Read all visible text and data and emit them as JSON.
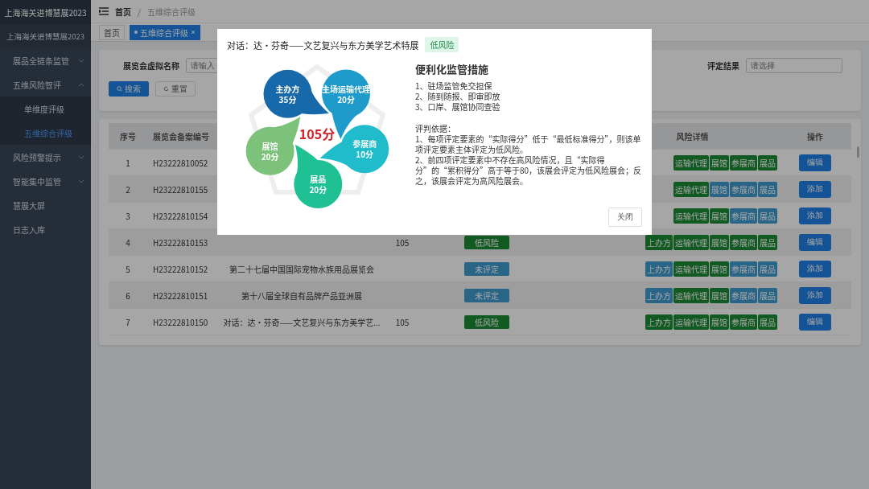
{
  "sidebar": {
    "title": "上海海关进博慧展2023",
    "subtitle": "上海海关进博慧展2023",
    "items": [
      {
        "label": "展品全链条监管",
        "expanded": false,
        "selected": false
      },
      {
        "label": "五维风险智评",
        "expanded": true,
        "selected": false,
        "children": [
          {
            "label": "单维度评级",
            "selected": false
          },
          {
            "label": "五维综合评级",
            "selected": true
          }
        ]
      },
      {
        "label": "风险预警提示",
        "expanded": false,
        "selected": false
      },
      {
        "label": "智能集中监管",
        "expanded": false,
        "selected": false
      },
      {
        "label": "慧展大屏",
        "selected": false
      },
      {
        "label": "日志入库",
        "selected": false
      }
    ]
  },
  "breadcrumb": [
    "首页",
    "五维综合评级"
  ],
  "breadcrumb_separator": "/",
  "tabs": [
    {
      "label": "首页",
      "selected": false
    },
    {
      "label": "五维综合评级",
      "selected": true
    }
  ],
  "search": {
    "fields": [
      {
        "label": "展览会虚拟名称",
        "placeholder": "请输入"
      },
      {
        "label": "评定结果",
        "placeholder": "请选择"
      }
    ],
    "buttons": [
      "搜索",
      "重置"
    ]
  },
  "table": {
    "columns": {
      "seq": "序号",
      "id": "展览会备案编号",
      "risk": "风险详情",
      "action": "操作"
    },
    "rows": [
      {
        "seq": "1",
        "id": "H23222810052",
        "risks": [
          {
            "label": "运输代理",
            "on": true
          },
          {
            "label": "展馆",
            "on": true
          },
          {
            "label": "参展商",
            "on": true
          },
          {
            "label": "展品",
            "on": true
          }
        ],
        "action": "编辑"
      },
      {
        "seq": "2",
        "id": "H23222810155",
        "risks": [
          {
            "label": "运输代理",
            "on": true
          },
          {
            "label": "展馆",
            "on": false
          },
          {
            "label": "参展商",
            "on": false
          },
          {
            "label": "展品",
            "on": false
          }
        ],
        "action": "添加"
      },
      {
        "seq": "3",
        "id": "H23222810154",
        "risks": [
          {
            "label": "运输代理",
            "on": true
          },
          {
            "label": "展馆",
            "on": true
          },
          {
            "label": "参展商",
            "on": false
          },
          {
            "label": "展品",
            "on": false
          }
        ],
        "action": "添加"
      },
      {
        "seq": "4",
        "id": "H23222810153",
        "score": "105",
        "result": {
          "label": "低风险",
          "rated": true
        },
        "risks": [
          {
            "label": "上办方",
            "on": true
          },
          {
            "label": "运输代理",
            "on": true
          },
          {
            "label": "展馆",
            "on": true
          },
          {
            "label": "参展商",
            "on": true
          },
          {
            "label": "展品",
            "on": true
          }
        ],
        "action": "编辑"
      },
      {
        "seq": "5",
        "id": "H23222810152",
        "name": "第二十七届中国国际宠物水族用品展览会",
        "result": {
          "label": "未评定",
          "rated": false
        },
        "risks": [
          {
            "label": "上办方",
            "on": false
          },
          {
            "label": "运输代理",
            "on": true
          },
          {
            "label": "展馆",
            "on": true
          },
          {
            "label": "参展商",
            "on": false
          },
          {
            "label": "展品",
            "on": false
          }
        ],
        "action": "添加"
      },
      {
        "seq": "6",
        "id": "H23222810151",
        "name": "第十八届全球自有品牌产品亚洲展",
        "result": {
          "label": "未评定",
          "rated": false
        },
        "risks": [
          {
            "label": "上办方",
            "on": false
          },
          {
            "label": "运输代理",
            "on": true
          },
          {
            "label": "展馆",
            "on": true
          },
          {
            "label": "参展商",
            "on": false
          },
          {
            "label": "展品",
            "on": false
          }
        ],
        "action": "添加"
      },
      {
        "seq": "7",
        "id": "H23222810150",
        "name": "对话：达·芬奇——文艺复兴与东方美学艺...",
        "score": "105",
        "result": {
          "label": "低风险",
          "rated": true
        },
        "risks": [
          {
            "label": "上办方",
            "on": true
          },
          {
            "label": "运输代理",
            "on": true
          },
          {
            "label": "展馆",
            "on": true
          },
          {
            "label": "参展商",
            "on": true
          },
          {
            "label": "展品",
            "on": true
          }
        ],
        "action": "编辑"
      }
    ]
  },
  "dialog": {
    "title": "对话：达·芬奇——文艺复兴与东方美学艺术特展",
    "badge": "低风险",
    "total": "105分",
    "petals": [
      {
        "name": "主办方",
        "score": "35分",
        "color": "#1769aa"
      },
      {
        "name": "主场运输代理",
        "score": "20分",
        "color": "#1e9bcb"
      },
      {
        "name": "参展商",
        "score": "10分",
        "color": "#20bccb"
      },
      {
        "name": "展品",
        "score": "20分",
        "color": "#20c095"
      },
      {
        "name": "展馆",
        "score": "20分",
        "color": "#7cc27a"
      }
    ],
    "heading": "便利化监管措施",
    "measures": [
      "1、驻场监管免交担保",
      "2、随到随报、即审即放",
      "3、口岸、展馆协同查验"
    ],
    "basis_title": "评判依据：",
    "basis": [
      "1、每项评定要素的“实际得分”低于“最低标准得分”，则该单项评定要素主体评定为低风险。",
      "2、前四项评定要素中不存在高风险情况，且“实际得分”的“累积得分”高于等于80，该展会评定为低风险展会；反之，该展会评定为高风险展会。"
    ],
    "close": "关闭"
  }
}
